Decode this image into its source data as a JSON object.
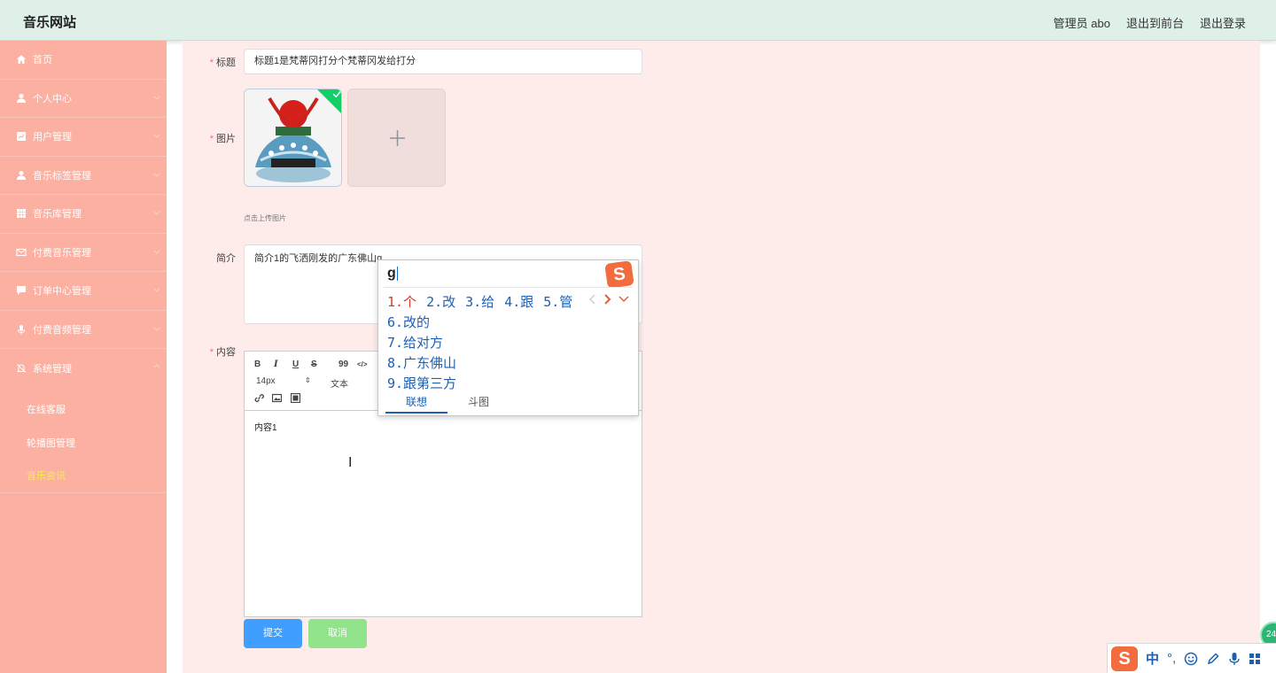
{
  "header": {
    "site_title": "音乐网站",
    "user_label": "管理员 abo",
    "front_link": "退出到前台",
    "logout_link": "退出登录"
  },
  "sidebar": {
    "items": [
      {
        "label": "首页",
        "icon": "home-icon",
        "has_chevron": false
      },
      {
        "label": "个人中心",
        "icon": "user-icon",
        "has_chevron": true
      },
      {
        "label": "用户管理",
        "icon": "chart-icon",
        "has_chevron": true
      },
      {
        "label": "音乐标签管理",
        "icon": "user-icon",
        "has_chevron": true
      },
      {
        "label": "音乐库管理",
        "icon": "grid-icon",
        "has_chevron": true
      },
      {
        "label": "付费音乐管理",
        "icon": "mail-icon",
        "has_chevron": true
      },
      {
        "label": "订单中心管理",
        "icon": "chat-icon",
        "has_chevron": true
      },
      {
        "label": "付费音频管理",
        "icon": "mic-icon",
        "has_chevron": true
      },
      {
        "label": "系统管理",
        "icon": "bell-icon",
        "has_chevron": true,
        "expanded": true
      }
    ],
    "subitems": [
      {
        "label": "在线客服"
      },
      {
        "label": "轮播图管理"
      },
      {
        "label": "音乐资讯",
        "active": true
      }
    ]
  },
  "form": {
    "title_label": "标题",
    "title_value": "标题1是梵蒂冈打分个梵蒂冈发给打分",
    "image_label": "图片",
    "upload_tip": "点击上传图片",
    "intro_label": "简介",
    "intro_value": "简介1的飞洒刚发的广东佛山g",
    "content_label": "内容",
    "content_value": "内容1",
    "submit_label": "提交",
    "cancel_label": "取消"
  },
  "editor_toolbar": {
    "bold": "B",
    "italic": "I",
    "underline": "U",
    "strike": "S",
    "quote": "99",
    "code": "</>",
    "font_size": "14px",
    "text_type": "文本"
  },
  "ime": {
    "input": "g",
    "row1": [
      "1.个",
      "2.改",
      "3.给",
      "4.跟",
      "5.管"
    ],
    "list": [
      "6.改的",
      "7.给对方",
      "8.广东佛山",
      "9.跟第三方"
    ],
    "tabs": [
      "联想",
      "斗图"
    ],
    "logo": "S"
  },
  "taskbar": {
    "lang": "中",
    "punct": "°,",
    "badge": "24"
  },
  "colors": {
    "header_bg": "#dff0e8",
    "sidebar_bg": "#fbb0a2",
    "main_bg": "#fdecea",
    "submit": "#409eff",
    "cancel": "#91e38c",
    "active_menu": "#f7ef4c"
  }
}
